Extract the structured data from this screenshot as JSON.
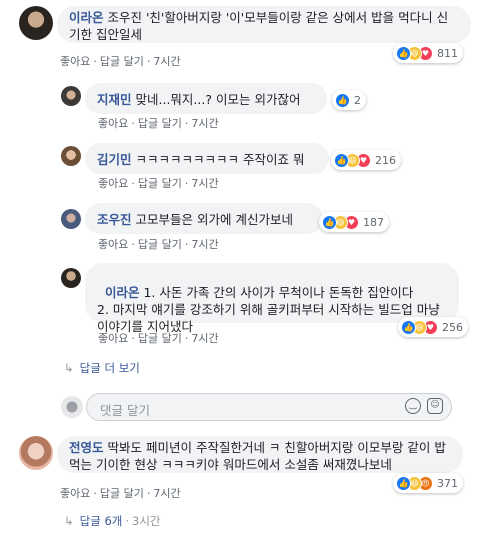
{
  "comments": [
    {
      "name": "이라온",
      "text": "조우진 '친'할아버지랑 '이'모부들이랑 같은 상에서 밥을 먹다니 신기한 집안일세",
      "like": "좋아요",
      "reply": "답글 달기",
      "time": "7시간",
      "reactions": "811"
    },
    {
      "name": "지재민",
      "text": "맞네...뭐지...? 이모는 외가잖어",
      "like": "좋아요",
      "reply": "답글 달기",
      "time": "7시간",
      "reactions": "2"
    },
    {
      "name": "김기민",
      "text": "ㅋㅋㅋㅋㅋㅋㅋㅋㅋ 주작이죠 뭐",
      "like": "좋아요",
      "reply": "답글 달기",
      "time": "7시간",
      "reactions": "216"
    },
    {
      "name": "조우진",
      "text": "고모부들은 외가에 계신가보네",
      "like": "좋아요",
      "reply": "답글 달기",
      "time": "7시간",
      "reactions": "187"
    },
    {
      "name": "이라온",
      "text": "1. 사돈 가족 간의 사이가 무척이나 돈독한 집안이다\n2. 마지막 얘기를 강조하기 위해 골키퍼부터 시작하는 빌드업 마냥 이야기를 지어냈다",
      "like": "좋아요",
      "reply": "답글 달기",
      "time": "7시간",
      "reactions": "256"
    },
    {
      "name": "전영도",
      "text": "딱봐도 페미년이 주작질한거네 ㅋ 친할아버지랑 이모부랑 같이 밥먹는 기이한 현상 ㅋㅋㅋ키야 워마드에서 소설좀 써재꼈나보네",
      "like": "좋아요",
      "reply": "답글 달기",
      "time": "7시간",
      "reactions": "371"
    }
  ],
  "more_replies": "답글 더 보기",
  "reply_box": {
    "placeholder": "댓글 달기"
  },
  "replies_count": "답글 6개",
  "replies_time": "3시간",
  "sep": "·"
}
